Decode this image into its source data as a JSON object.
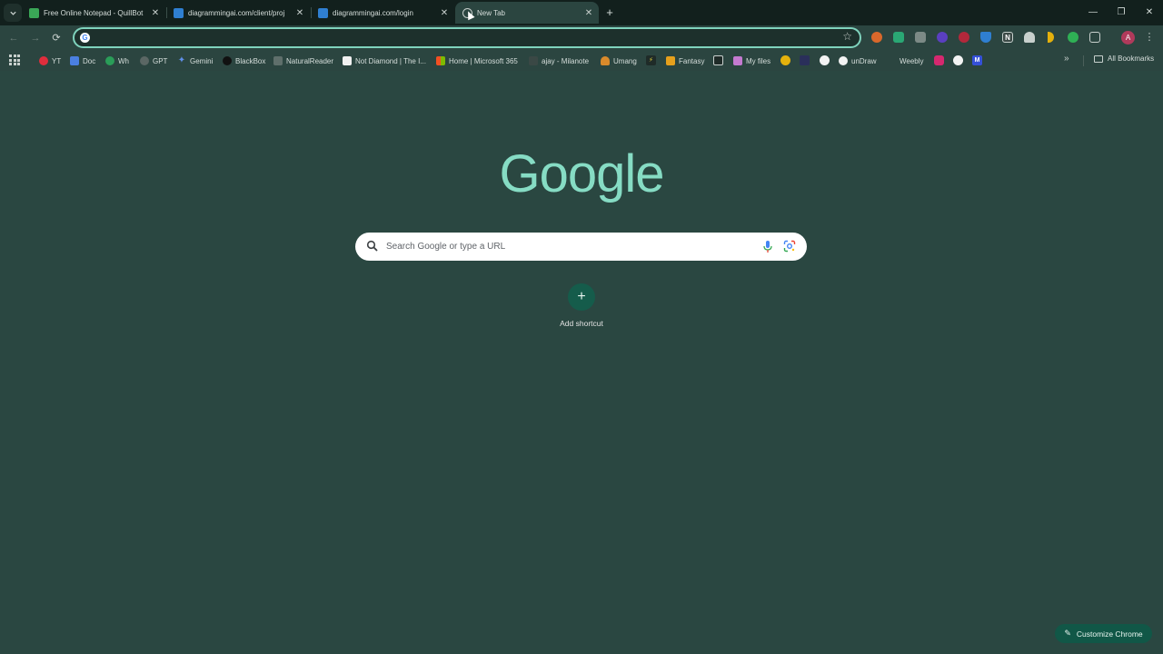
{
  "tabs": [
    {
      "title": "Free Online Notepad - QuillBot",
      "favicon_color": "#3aa757",
      "favicon_icon": "quillbot-icon",
      "active": false
    },
    {
      "title": "diagrammingai.com/client/proj",
      "favicon_color": "#2f7fd1",
      "favicon_icon": "diagrammingai-icon",
      "active": false
    },
    {
      "title": "diagrammingai.com/login",
      "favicon_color": "#2f7fd1",
      "favicon_icon": "diagrammingai-icon",
      "active": false
    },
    {
      "title": "New Tab",
      "favicon_color": "#c8d0cd",
      "favicon_icon": "chrome-icon",
      "active": true
    }
  ],
  "tab_close": "✕",
  "new_tab": "+",
  "window_controls": {
    "minimize": "—",
    "restore": "❐",
    "close": "✕"
  },
  "toolbar": {
    "back": "←",
    "forward": "→",
    "reload": "⟳",
    "omnibox_value": "",
    "star": "☆",
    "profile_initial": "A",
    "menu": "⋮",
    "extensions": [
      {
        "icon": "extension-orange-icon",
        "color": "#d9682b"
      },
      {
        "icon": "extension-green-icon",
        "color": "#2aa774"
      },
      {
        "icon": "extension-gray-icon",
        "color": "#7c8a86"
      },
      {
        "icon": "extension-purple-icon",
        "color": "#5a3fc0"
      },
      {
        "icon": "extension-red-icon",
        "color": "#b3283b"
      },
      {
        "icon": "extension-shield-icon",
        "color": "#2f7fd1"
      },
      {
        "icon": "notion-icon",
        "color": "#3c4a47"
      },
      {
        "icon": "extension-cloud-icon",
        "color": "#c8d0cd"
      },
      {
        "icon": "extension-yellow-icon",
        "color": "#e5b10c"
      },
      {
        "icon": "extension-greenlink-icon",
        "color": "#2fb055"
      },
      {
        "icon": "puzzle-icon",
        "color": "#5f6f6b"
      }
    ]
  },
  "bookmarks": [
    {
      "label": "YT",
      "icon": "youtube-icon",
      "color": "#e02d3c"
    },
    {
      "label": "Doc",
      "icon": "docs-icon",
      "color": "#4a7fe0"
    },
    {
      "label": "Wh",
      "icon": "whatsapp-icon",
      "color": "#2a9d58"
    },
    {
      "label": "GPT",
      "icon": "openai-icon",
      "color": "#5b6764"
    },
    {
      "label": "Gemini",
      "icon": "gemini-icon",
      "color": "#5f8fe8"
    },
    {
      "label": "BlackBox",
      "icon": "blackbox-icon",
      "color": "#111111"
    },
    {
      "label": "NaturalReader",
      "icon": "naturalreader-icon",
      "color": "#5f6f6b"
    },
    {
      "label": "Not Diamond | The I...",
      "icon": "notdiamond-icon",
      "color": "#f1f1f1"
    },
    {
      "label": "Home | Microsoft 365",
      "icon": "microsoft-icon",
      "color": "#e3a21a"
    },
    {
      "label": "ajay - Milanote",
      "icon": "milanote-icon",
      "color": "#3a4845"
    },
    {
      "label": "Umang",
      "icon": "umang-icon",
      "color": "#d98a2b"
    },
    {
      "label": "",
      "icon": "bolt-icon",
      "color": "#1f2b28"
    },
    {
      "label": "Fantasy",
      "icon": "fantasy-icon",
      "color": "#e6a01c"
    },
    {
      "label": "",
      "icon": "bookmark-square-icon",
      "color": "#1f2b28"
    },
    {
      "label": "My files",
      "icon": "files-icon",
      "color": "#c47ad0"
    },
    {
      "label": "",
      "icon": "smiley-icon",
      "color": "#e5b10c"
    },
    {
      "label": "",
      "icon": "pen-tool-icon",
      "color": "#2a2f5a"
    },
    {
      "label": "",
      "icon": "edit-icon",
      "color": "#f3f3f3"
    },
    {
      "label": "unDraw",
      "icon": "undraw-icon",
      "color": "#f3f3f3"
    },
    {
      "label": "Weebly",
      "icon": "weebly-icon",
      "color": "#2b4540"
    },
    {
      "label": "",
      "icon": "instagram-icon",
      "color": "#d6286f"
    },
    {
      "label": "",
      "icon": "circle-icon",
      "color": "#f3f3f3"
    },
    {
      "label": "",
      "icon": "m-icon",
      "color": "#3550d8"
    }
  ],
  "bookmarks_more": "»",
  "all_bookmarks": "All Bookmarks",
  "ntp": {
    "logo": "Google",
    "search_placeholder": "Search Google or type a URL",
    "add_shortcut_icon": "+",
    "add_shortcut_label": "Add shortcut",
    "customize_label": "Customize Chrome"
  }
}
